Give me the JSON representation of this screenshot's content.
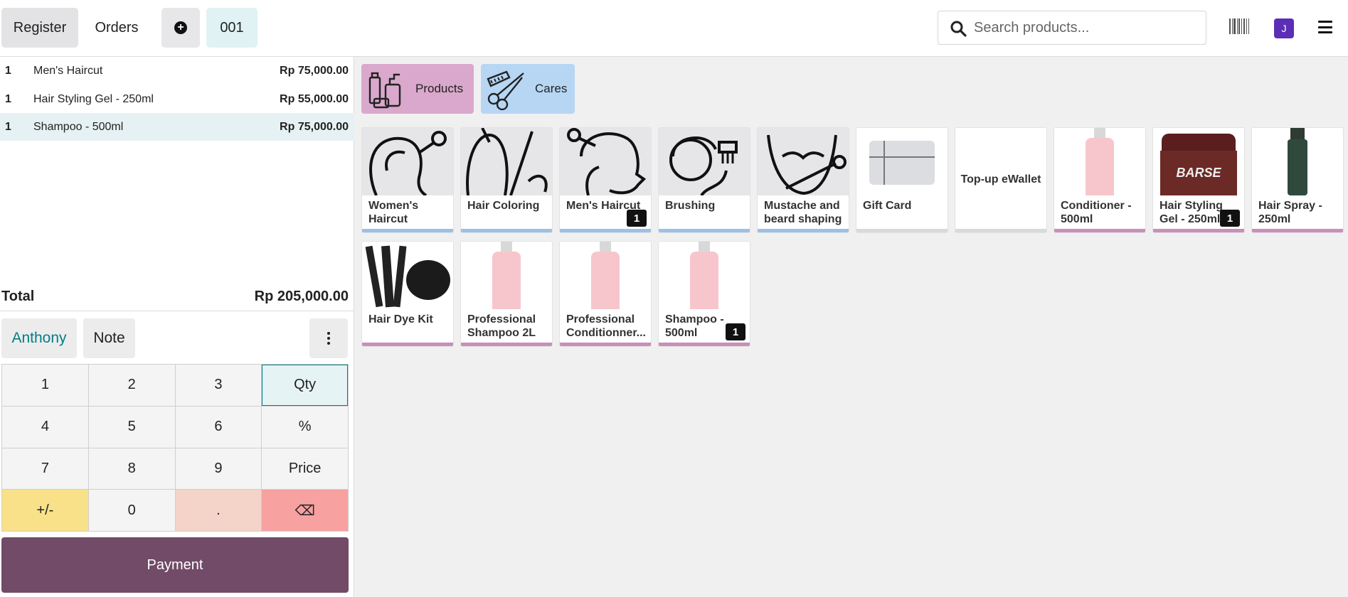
{
  "header": {
    "register_label": "Register",
    "orders_label": "Orders",
    "order_number": "001",
    "search_placeholder": "Search products...",
    "user_initial": "J"
  },
  "order_lines": [
    {
      "qty": "1",
      "name": "Men's Haircut",
      "price": "Rp 75,000.00"
    },
    {
      "qty": "1",
      "name": "Hair Styling Gel - 250ml",
      "price": "Rp 55,000.00"
    },
    {
      "qty": "1",
      "name": "Shampoo - 500ml",
      "price": "Rp 75,000.00"
    }
  ],
  "total": {
    "label": "Total",
    "value": "Rp 205,000.00"
  },
  "customer": {
    "name": "Anthony",
    "note_label": "Note"
  },
  "numpad": {
    "keys": [
      "1",
      "2",
      "3",
      "Qty",
      "4",
      "5",
      "6",
      "%",
      "7",
      "8",
      "9",
      "Price",
      "+/-",
      "0",
      ".",
      "⌫"
    ]
  },
  "payment_label": "Payment",
  "categories": [
    {
      "name": "Products",
      "color": "#daa8cc"
    },
    {
      "name": "Cares",
      "color": "#b6d6f4"
    }
  ],
  "products": [
    {
      "name": "Women's Haircut",
      "badge": ""
    },
    {
      "name": "Hair Coloring",
      "badge": ""
    },
    {
      "name": "Men's Haircut",
      "badge": "1"
    },
    {
      "name": "Brushing",
      "badge": ""
    },
    {
      "name": "Mustache and beard shaping",
      "badge": ""
    },
    {
      "name": "Gift Card",
      "badge": ""
    },
    {
      "name": "Top-up eWallet",
      "badge": ""
    },
    {
      "name": "Conditioner - 500ml",
      "badge": ""
    },
    {
      "name": "Hair Styling Gel - 250ml",
      "badge": "1"
    },
    {
      "name": "Hair Spray - 250ml",
      "badge": ""
    },
    {
      "name": "Hair Dye Kit",
      "badge": ""
    },
    {
      "name": "Professional Shampoo 2L",
      "badge": ""
    },
    {
      "name": "Professional Conditionner...",
      "badge": ""
    },
    {
      "name": "Shampoo - 500ml",
      "badge": "1"
    }
  ]
}
